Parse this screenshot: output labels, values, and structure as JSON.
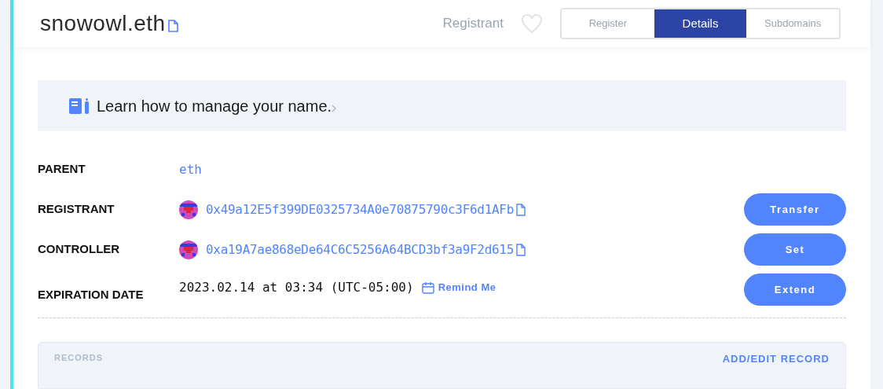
{
  "header": {
    "title": "snowowl.eth",
    "role": "Registrant"
  },
  "tabs": [
    {
      "label": "Register",
      "selected": false
    },
    {
      "label": "Details",
      "selected": true
    },
    {
      "label": "Subdomains",
      "selected": false
    }
  ],
  "banner": {
    "text": "Learn how to manage your name."
  },
  "details": [
    {
      "kind": "link",
      "label": "PARENT",
      "value": "eth"
    },
    {
      "kind": "address",
      "label": "REGISTRANT",
      "value": "0x49a12E5f399DE0325734A0e70875790c3F6d1AFb",
      "action": "Transfer"
    },
    {
      "kind": "address",
      "label": "CONTROLLER",
      "value": "0xa19A7ae868eDe64C6C5256A64BCD3bf3a9F2d615",
      "action": "Set"
    },
    {
      "kind": "date",
      "label": "EXPIRATION DATE",
      "value": "2023.02.14 at 03:34 (UTC-05:00)",
      "reminder": "Remind Me",
      "action": "Extend"
    }
  ],
  "records": {
    "title": "RECORDS",
    "action": "ADD/EDIT RECORD"
  }
}
